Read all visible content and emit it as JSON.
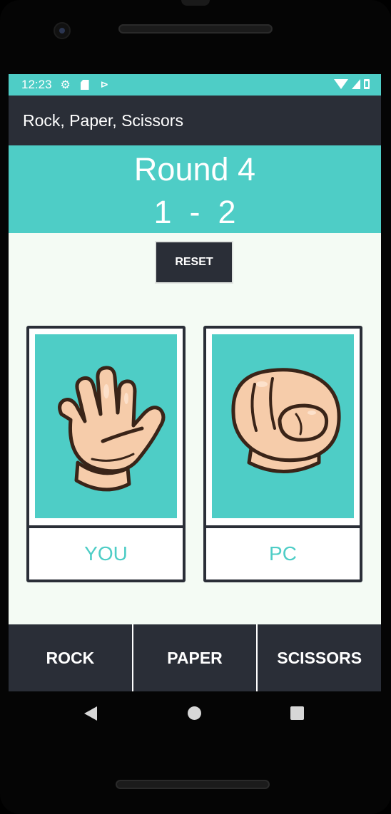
{
  "status_bar": {
    "time": "12:23",
    "icons": [
      "gear-icon",
      "sd-card-icon",
      "play-store-icon",
      "wifi-icon",
      "signal-icon",
      "battery-icon"
    ]
  },
  "app_bar": {
    "title": "Rock, Paper, Scissors"
  },
  "scoreboard": {
    "round_label": "Round 4",
    "score_text": "1  -  2"
  },
  "reset_button": {
    "label": "RESET"
  },
  "cards": {
    "you": {
      "label": "YOU",
      "choice_icon": "open-hand-paper-icon"
    },
    "pc": {
      "label": "PC",
      "choice_icon": "fist-rock-icon"
    }
  },
  "choices": [
    {
      "label": "ROCK"
    },
    {
      "label": "PAPER"
    },
    {
      "label": "SCISSORS"
    }
  ],
  "colors": {
    "accent": "#4ecdc6",
    "dark": "#2a2e37",
    "background": "#f4fbf4",
    "skin": "#f6ccaa",
    "outline": "#3a2418"
  }
}
